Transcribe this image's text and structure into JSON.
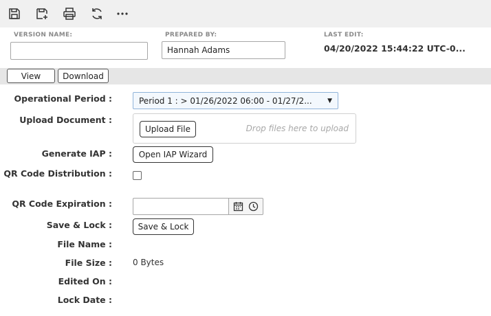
{
  "toolbar": {
    "icons": [
      "save-icon",
      "save-as-icon",
      "print-icon",
      "refresh-icon",
      "more-icon"
    ]
  },
  "header": {
    "version_name_label": "VERSION NAME:",
    "version_name_value": "",
    "prepared_by_label": "PREPARED BY:",
    "prepared_by_value": "Hannah Adams",
    "last_edit_label": "LAST EDIT:",
    "last_edit_value": "04/20/2022 15:44:22 UTC-0..."
  },
  "tabs": {
    "view": "View",
    "download": "Download"
  },
  "form": {
    "operational_period": {
      "label": "Operational Period :",
      "selected": "Period 1 : > 01/26/2022 06:00 - 01/27/2..."
    },
    "upload_document": {
      "label": "Upload Document :",
      "button": "Upload File",
      "drop_hint": "Drop files here to upload"
    },
    "generate_iap": {
      "label": "Generate IAP :",
      "button": "Open IAP Wizard"
    },
    "qr_distribution": {
      "label": "QR Code Distribution :",
      "checked": false
    },
    "qr_expiration": {
      "label": "QR Code Expiration :",
      "value": ""
    },
    "save_lock": {
      "label": "Save & Lock :",
      "button": "Save & Lock"
    },
    "file_name": {
      "label": "File Name :",
      "value": ""
    },
    "file_size": {
      "label": "File Size :",
      "value": "0 Bytes"
    },
    "edited_on": {
      "label": "Edited On :",
      "value": ""
    },
    "lock_date": {
      "label": "Lock Date :",
      "value": ""
    }
  }
}
